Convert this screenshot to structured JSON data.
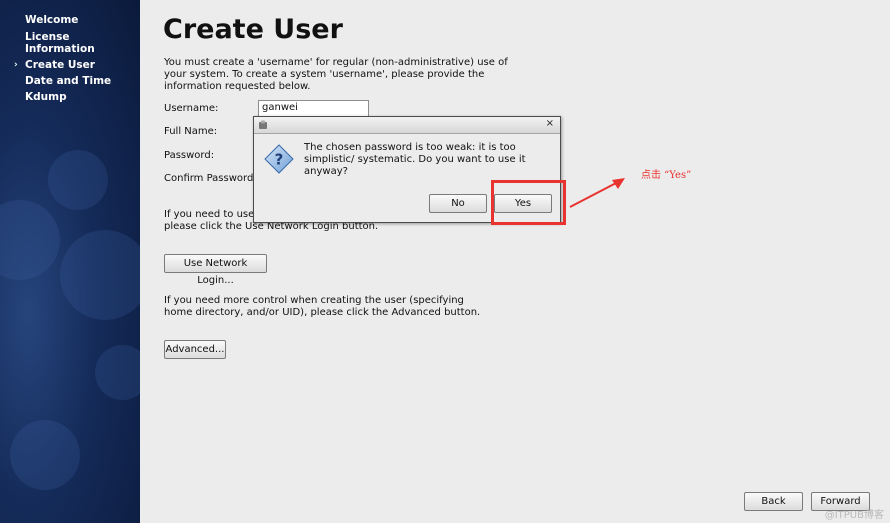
{
  "sidebar": {
    "items": [
      {
        "label": "Welcome",
        "active": false
      },
      {
        "label": "License Information",
        "active": false
      },
      {
        "label": "Create User",
        "active": true
      },
      {
        "label": "Date and Time",
        "active": false
      },
      {
        "label": "Kdump",
        "active": false
      }
    ],
    "active_marker": "›"
  },
  "main": {
    "title": "Create User",
    "intro": "You must create a 'username' for regular (non-administrative) use of your system.  To create a system 'username', please provide the information requested below.",
    "fields": {
      "username_label": "Username:",
      "username_value": "ganwei",
      "fullname_label": "Full Name:",
      "password_label": "Password:",
      "confirm_label": "Confirm Password:"
    },
    "network_text_part1": "If you need to use",
    "network_text_part2": "please click the Use Network Login button.",
    "network_button": "Use Network Login...",
    "advanced_text": "If you need more control when creating the user (specifying home directory, and/or UID), please click the Advanced button.",
    "advanced_button": "Advanced..."
  },
  "dialog": {
    "close_glyph": "×",
    "message": "The chosen password is too weak: it is too simplistic/ systematic. Do you want to use it anyway?",
    "no_label": "No",
    "yes_label": "Yes"
  },
  "annotation": {
    "text": "点击 “Yes”",
    "color": "#e8332e"
  },
  "footer": {
    "back_label": "Back",
    "forward_label": "Forward",
    "watermark": "@ITPUB博客"
  }
}
